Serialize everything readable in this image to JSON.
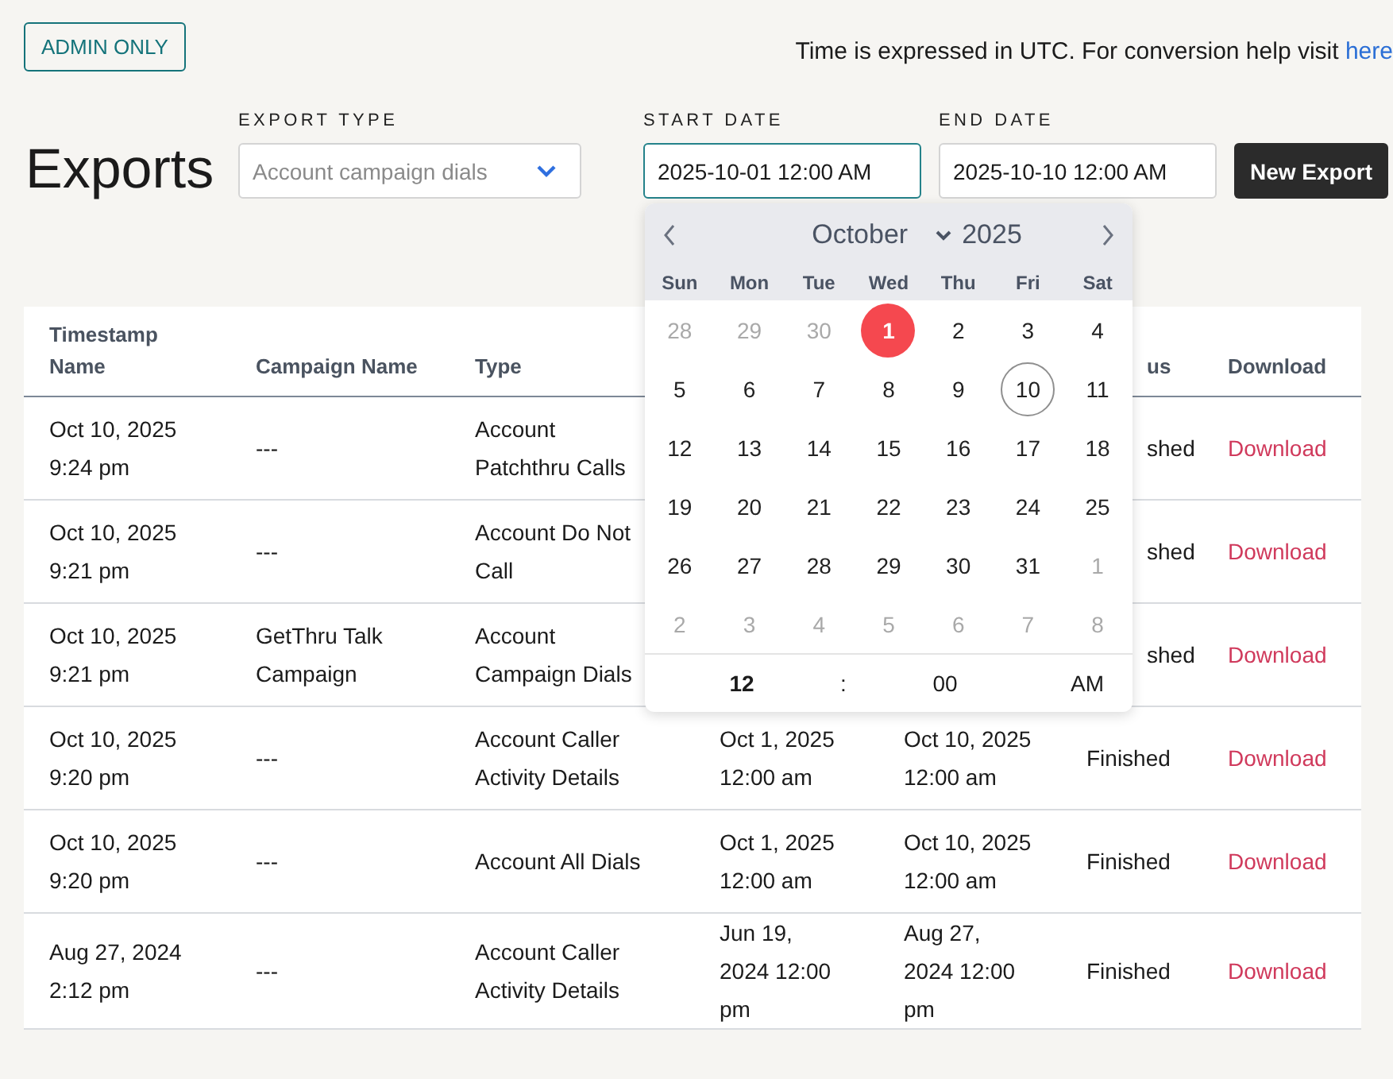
{
  "admin_button": "ADMIN ONLY",
  "timezone_note": {
    "text": "Time is expressed in UTC. For conversion help visit ",
    "link": "here"
  },
  "title": "Exports",
  "form": {
    "export_type": {
      "label": "EXPORT TYPE",
      "placeholder": "Account campaign dials"
    },
    "start_date": {
      "label": "START DATE",
      "value": "2025-10-01 12:00 AM",
      "focused": true
    },
    "end_date": {
      "label": "END DATE",
      "value": "2025-10-10 12:00 AM",
      "focused": false
    },
    "submit": "New Export"
  },
  "calendar": {
    "open": true,
    "month": "October",
    "year": "2025",
    "weekdays": [
      "Sun",
      "Mon",
      "Tue",
      "Wed",
      "Thu",
      "Fri",
      "Sat"
    ],
    "days": [
      {
        "label": "28",
        "outside": true,
        "selected": false,
        "today": false
      },
      {
        "label": "29",
        "outside": true,
        "selected": false,
        "today": false
      },
      {
        "label": "30",
        "outside": true,
        "selected": false,
        "today": false
      },
      {
        "label": "1",
        "outside": false,
        "selected": true,
        "today": false
      },
      {
        "label": "2",
        "outside": false,
        "selected": false,
        "today": false
      },
      {
        "label": "3",
        "outside": false,
        "selected": false,
        "today": false
      },
      {
        "label": "4",
        "outside": false,
        "selected": false,
        "today": false
      },
      {
        "label": "5",
        "outside": false,
        "selected": false,
        "today": false
      },
      {
        "label": "6",
        "outside": false,
        "selected": false,
        "today": false
      },
      {
        "label": "7",
        "outside": false,
        "selected": false,
        "today": false
      },
      {
        "label": "8",
        "outside": false,
        "selected": false,
        "today": false
      },
      {
        "label": "9",
        "outside": false,
        "selected": false,
        "today": false
      },
      {
        "label": "10",
        "outside": false,
        "selected": false,
        "today": true
      },
      {
        "label": "11",
        "outside": false,
        "selected": false,
        "today": false
      },
      {
        "label": "12",
        "outside": false,
        "selected": false,
        "today": false
      },
      {
        "label": "13",
        "outside": false,
        "selected": false,
        "today": false
      },
      {
        "label": "14",
        "outside": false,
        "selected": false,
        "today": false
      },
      {
        "label": "15",
        "outside": false,
        "selected": false,
        "today": false
      },
      {
        "label": "16",
        "outside": false,
        "selected": false,
        "today": false
      },
      {
        "label": "17",
        "outside": false,
        "selected": false,
        "today": false
      },
      {
        "label": "18",
        "outside": false,
        "selected": false,
        "today": false
      },
      {
        "label": "19",
        "outside": false,
        "selected": false,
        "today": false
      },
      {
        "label": "20",
        "outside": false,
        "selected": false,
        "today": false
      },
      {
        "label": "21",
        "outside": false,
        "selected": false,
        "today": false
      },
      {
        "label": "22",
        "outside": false,
        "selected": false,
        "today": false
      },
      {
        "label": "23",
        "outside": false,
        "selected": false,
        "today": false
      },
      {
        "label": "24",
        "outside": false,
        "selected": false,
        "today": false
      },
      {
        "label": "25",
        "outside": false,
        "selected": false,
        "today": false
      },
      {
        "label": "26",
        "outside": false,
        "selected": false,
        "today": false
      },
      {
        "label": "27",
        "outside": false,
        "selected": false,
        "today": false
      },
      {
        "label": "28",
        "outside": false,
        "selected": false,
        "today": false
      },
      {
        "label": "29",
        "outside": false,
        "selected": false,
        "today": false
      },
      {
        "label": "30",
        "outside": false,
        "selected": false,
        "today": false
      },
      {
        "label": "31",
        "outside": false,
        "selected": false,
        "today": false
      },
      {
        "label": "1",
        "outside": true,
        "selected": false,
        "today": false
      },
      {
        "label": "2",
        "outside": true,
        "selected": false,
        "today": false
      },
      {
        "label": "3",
        "outside": true,
        "selected": false,
        "today": false
      },
      {
        "label": "4",
        "outside": true,
        "selected": false,
        "today": false
      },
      {
        "label": "5",
        "outside": true,
        "selected": false,
        "today": false
      },
      {
        "label": "6",
        "outside": true,
        "selected": false,
        "today": false
      },
      {
        "label": "7",
        "outside": true,
        "selected": false,
        "today": false
      },
      {
        "label": "8",
        "outside": true,
        "selected": false,
        "today": false
      }
    ],
    "time": {
      "hour": "12",
      "separator": ":",
      "minute": "00",
      "period": "AM"
    }
  },
  "table": {
    "columns": [
      "Timestamp\nName",
      "Campaign Name",
      "Type",
      "us",
      "Download"
    ],
    "rows": [
      {
        "timestamp": "Oct 10, 2025\n9:24 pm",
        "campaign": "---",
        "type": "Account\nPatchthru Calls",
        "status": "shed",
        "download": "Download"
      },
      {
        "timestamp": "Oct 10, 2025\n9:21 pm",
        "campaign": "---",
        "type": "Account Do Not\nCall",
        "status": "shed",
        "download": "Download"
      },
      {
        "timestamp": "Oct 10, 2025\n9:21 pm",
        "campaign": "GetThru Talk\nCampaign",
        "type": "Account\nCampaign Dials",
        "status": "shed",
        "download": "Download"
      },
      {
        "timestamp": "Oct 10, 2025\n9:20 pm",
        "campaign": "---",
        "type": "Account Caller\nActivity Details",
        "start": "Oct 1, 2025\n12:00 am",
        "end": "Oct 10, 2025\n12:00 am",
        "status": "Finished",
        "download": "Download"
      },
      {
        "timestamp": "Oct 10, 2025\n9:20 pm",
        "campaign": "---",
        "type": "Account All Dials",
        "start": "Oct 1, 2025\n12:00 am",
        "end": "Oct 10, 2025\n12:00 am",
        "status": "Finished",
        "download": "Download"
      },
      {
        "timestamp": "Aug 27, 2024\n2:12 pm",
        "campaign": "---",
        "type": "Account Caller\nActivity Details",
        "start": "Jun 19,\n2024 12:00\npm",
        "end": "Aug 27,\n2024 12:00\npm",
        "status": "Finished",
        "download": "Download"
      }
    ]
  }
}
